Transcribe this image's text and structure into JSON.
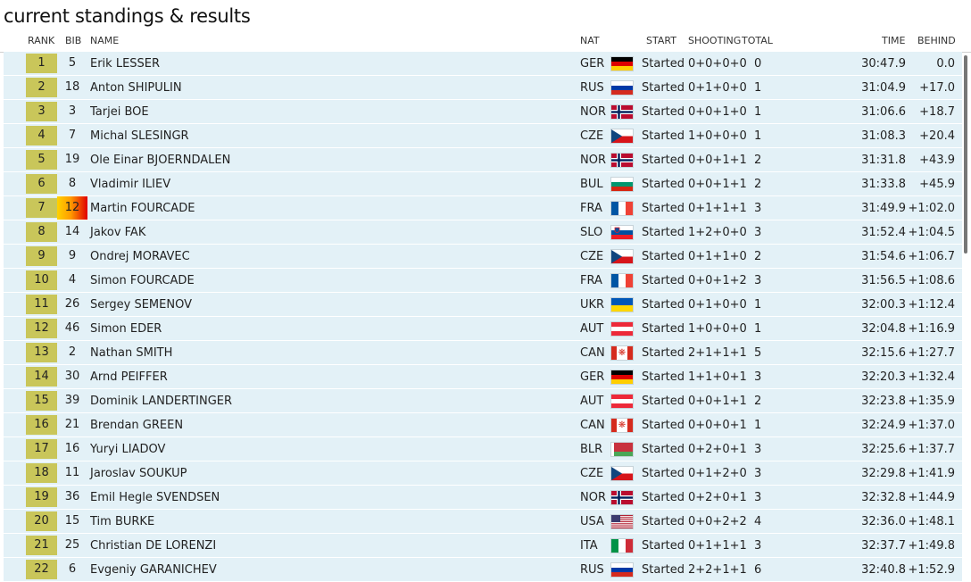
{
  "page_title": "current standings & results",
  "headers": {
    "rank": "RANK",
    "bib": "BIB",
    "name": "NAME",
    "nat": "NAT",
    "start": "START",
    "shooting": "SHOOTING",
    "total": "TOTAL",
    "time": "TIME",
    "behind": "BEHIND"
  },
  "rows": [
    {
      "rank": "1",
      "bib": "5",
      "name": "Erik LESSER",
      "nat": "GER",
      "flag": "germany",
      "start": "Started",
      "shooting": "0+0+0+0",
      "total": "0",
      "time": "30:47.9",
      "behind": "0.0"
    },
    {
      "rank": "2",
      "bib": "18",
      "name": "Anton SHIPULIN",
      "nat": "RUS",
      "flag": "russia",
      "start": "Started",
      "shooting": "0+1+0+0",
      "total": "1",
      "time": "31:04.9",
      "behind": "+17.0"
    },
    {
      "rank": "3",
      "bib": "3",
      "name": "Tarjei BOE",
      "nat": "NOR",
      "flag": "norway",
      "start": "Started",
      "shooting": "0+0+1+0",
      "total": "1",
      "time": "31:06.6",
      "behind": "+18.7"
    },
    {
      "rank": "4",
      "bib": "7",
      "name": "Michal SLESINGR",
      "nat": "CZE",
      "flag": "czech",
      "start": "Started",
      "shooting": "1+0+0+0",
      "total": "1",
      "time": "31:08.3",
      "behind": "+20.4"
    },
    {
      "rank": "5",
      "bib": "19",
      "name": "Ole Einar BJOERNDALEN",
      "nat": "NOR",
      "flag": "norway",
      "start": "Started",
      "shooting": "0+0+1+1",
      "total": "2",
      "time": "31:31.8",
      "behind": "+43.9"
    },
    {
      "rank": "6",
      "bib": "8",
      "name": "Vladimir ILIEV",
      "nat": "BUL",
      "flag": "bulgaria",
      "start": "Started",
      "shooting": "0+0+1+1",
      "total": "2",
      "time": "31:33.8",
      "behind": "+45.9"
    },
    {
      "rank": "7",
      "bib": "12",
      "name": "Martin FOURCADE",
      "nat": "FRA",
      "flag": "france",
      "start": "Started",
      "shooting": "0+1+1+1",
      "total": "3",
      "time": "31:49.9",
      "behind": "+1:02.0",
      "highlight": true
    },
    {
      "rank": "8",
      "bib": "14",
      "name": "Jakov FAK",
      "nat": "SLO",
      "flag": "slovenia",
      "start": "Started",
      "shooting": "1+2+0+0",
      "total": "3",
      "time": "31:52.4",
      "behind": "+1:04.5"
    },
    {
      "rank": "9",
      "bib": "9",
      "name": "Ondrej MORAVEC",
      "nat": "CZE",
      "flag": "czech",
      "start": "Started",
      "shooting": "0+1+1+0",
      "total": "2",
      "time": "31:54.6",
      "behind": "+1:06.7"
    },
    {
      "rank": "10",
      "bib": "4",
      "name": "Simon FOURCADE",
      "nat": "FRA",
      "flag": "france",
      "start": "Started",
      "shooting": "0+0+1+2",
      "total": "3",
      "time": "31:56.5",
      "behind": "+1:08.6"
    },
    {
      "rank": "11",
      "bib": "26",
      "name": "Sergey SEMENOV",
      "nat": "UKR",
      "flag": "ukraine",
      "start": "Started",
      "shooting": "0+1+0+0",
      "total": "1",
      "time": "32:00.3",
      "behind": "+1:12.4"
    },
    {
      "rank": "12",
      "bib": "46",
      "name": "Simon EDER",
      "nat": "AUT",
      "flag": "austria",
      "start": "Started",
      "shooting": "1+0+0+0",
      "total": "1",
      "time": "32:04.8",
      "behind": "+1:16.9"
    },
    {
      "rank": "13",
      "bib": "2",
      "name": "Nathan SMITH",
      "nat": "CAN",
      "flag": "canada",
      "start": "Started",
      "shooting": "2+1+1+1",
      "total": "5",
      "time": "32:15.6",
      "behind": "+1:27.7"
    },
    {
      "rank": "14",
      "bib": "30",
      "name": "Arnd PEIFFER",
      "nat": "GER",
      "flag": "germany",
      "start": "Started",
      "shooting": "1+1+0+1",
      "total": "3",
      "time": "32:20.3",
      "behind": "+1:32.4"
    },
    {
      "rank": "15",
      "bib": "39",
      "name": "Dominik LANDERTINGER",
      "nat": "AUT",
      "flag": "austria",
      "start": "Started",
      "shooting": "0+0+1+1",
      "total": "2",
      "time": "32:23.8",
      "behind": "+1:35.9"
    },
    {
      "rank": "16",
      "bib": "21",
      "name": "Brendan GREEN",
      "nat": "CAN",
      "flag": "canada",
      "start": "Started",
      "shooting": "0+0+0+1",
      "total": "1",
      "time": "32:24.9",
      "behind": "+1:37.0"
    },
    {
      "rank": "17",
      "bib": "16",
      "name": "Yuryi LIADOV",
      "nat": "BLR",
      "flag": "belarus",
      "start": "Started",
      "shooting": "0+2+0+1",
      "total": "3",
      "time": "32:25.6",
      "behind": "+1:37.7"
    },
    {
      "rank": "18",
      "bib": "11",
      "name": "Jaroslav SOUKUP",
      "nat": "CZE",
      "flag": "czech",
      "start": "Started",
      "shooting": "0+1+2+0",
      "total": "3",
      "time": "32:29.8",
      "behind": "+1:41.9"
    },
    {
      "rank": "19",
      "bib": "36",
      "name": "Emil Hegle SVENDSEN",
      "nat": "NOR",
      "flag": "norway",
      "start": "Started",
      "shooting": "0+2+0+1",
      "total": "3",
      "time": "32:32.8",
      "behind": "+1:44.9"
    },
    {
      "rank": "20",
      "bib": "15",
      "name": "Tim BURKE",
      "nat": "USA",
      "flag": "usa",
      "start": "Started",
      "shooting": "0+0+2+2",
      "total": "4",
      "time": "32:36.0",
      "behind": "+1:48.1"
    },
    {
      "rank": "21",
      "bib": "25",
      "name": "Christian DE LORENZI",
      "nat": "ITA",
      "flag": "italy",
      "start": "Started",
      "shooting": "0+1+1+1",
      "total": "3",
      "time": "32:37.7",
      "behind": "+1:49.8"
    },
    {
      "rank": "22",
      "bib": "6",
      "name": "Evgeniy GARANICHEV",
      "nat": "RUS",
      "flag": "russia",
      "start": "Started",
      "shooting": "2+2+1+1",
      "total": "6",
      "time": "32:40.8",
      "behind": "+1:52.9"
    }
  ],
  "colors": {
    "row_bg": "#e3f1f7",
    "rank_bg": "#c9c65a"
  }
}
